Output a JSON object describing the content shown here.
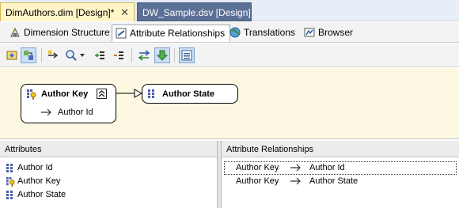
{
  "doc_tabs": [
    {
      "label": "DimAuthors.dim [Design]*",
      "close": "✕"
    },
    {
      "label": "DW_Sample.dsv [Design]"
    }
  ],
  "designer_tabs": [
    {
      "label": "Dimension Structure"
    },
    {
      "label": "Attribute Relationships"
    },
    {
      "label": "Translations"
    },
    {
      "label": "Browser"
    }
  ],
  "diagram": {
    "nodes": [
      {
        "title": "Author Key",
        "children": [
          "Author Id"
        ]
      },
      {
        "title": "Author State"
      }
    ]
  },
  "attributes_pane": {
    "header": "Attributes",
    "items": [
      {
        "label": "Author Id",
        "icon": "attribute-grid-icon"
      },
      {
        "label": "Author Key",
        "icon": "key-attribute-icon"
      },
      {
        "label": "Author State",
        "icon": "attribute-grid-icon"
      }
    ]
  },
  "relationships_pane": {
    "header": "Attribute Relationships",
    "rows": [
      {
        "from": "Author Key",
        "to": "Author Id"
      },
      {
        "from": "Author Key",
        "to": "Author State"
      }
    ]
  },
  "colors": {
    "active_doc_tab": "#fff5c6",
    "inactive_doc_tab": "#5b7095",
    "diagram_background": "#fdf8e1",
    "toolbar_pressed": "#ccdff6"
  }
}
